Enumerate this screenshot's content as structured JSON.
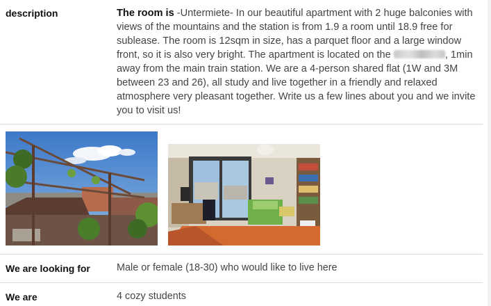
{
  "description": {
    "label": "description",
    "lead": "The room is",
    "text_before": " -Untermiete- In our beautiful apartment with 2 huge balconies with views of the mountains and the station is from 1.9 a room until 18.9 free for sublease. The room is 12sqm in size, has a parquet floor and a large window front, so it is also very bright. The apartment is located on the ",
    "text_after": ", 1min away from the main train station. We are a 4-person shared flat (1W and 3M between 23 and 26), all study and live together in a friendly and relaxed atmosphere very pleasant together. Write us a few lines about you and we invite you to visit us!"
  },
  "photos": [
    {
      "name": "balcony-photo"
    },
    {
      "name": "room-photo"
    }
  ],
  "looking_for": {
    "label": "We are looking for",
    "value": "Male or female (18-30) who would like to live here"
  },
  "we_are": {
    "label": "We are",
    "value": "4 cozy students"
  }
}
